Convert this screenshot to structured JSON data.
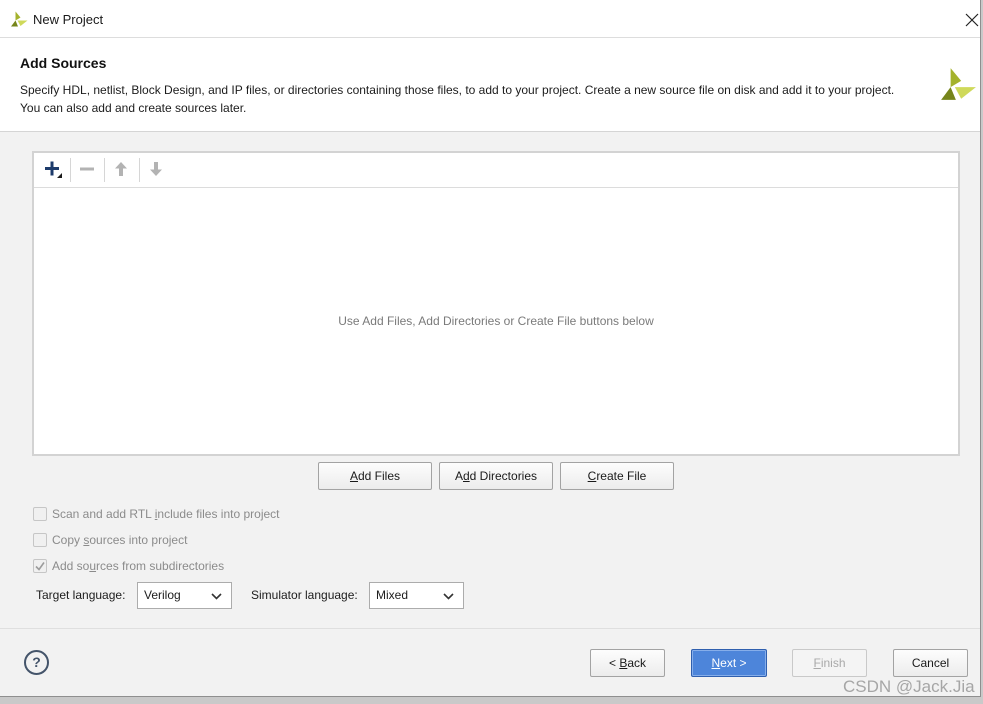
{
  "window": {
    "title": "New Project"
  },
  "header": {
    "title": "Add Sources",
    "description_lines": [
      "Specify HDL, netlist, Block Design, and IP files, or directories containing those files, to add to your project. Create a new source file on disk and add it to your project.",
      "You can also add and create sources later."
    ]
  },
  "sources_panel": {
    "toolbar": [
      {
        "icon": "plus-icon",
        "enabled": true
      },
      {
        "icon": "minus-icon",
        "enabled": false
      },
      {
        "icon": "arrow-up-icon",
        "enabled": false
      },
      {
        "icon": "arrow-down-icon",
        "enabled": false
      }
    ],
    "empty_message": "Use Add Files, Add Directories or Create File buttons below"
  },
  "source_buttons": {
    "add_files": "Add Files",
    "add_directories": "Add Directories",
    "create_file": "Create File"
  },
  "options": [
    {
      "label": "Scan and add RTL include files into project",
      "checked": false,
      "enabled": false
    },
    {
      "label": "Copy sources into project",
      "checked": false,
      "enabled": false
    },
    {
      "label": "Add sources from subdirectories",
      "checked": true,
      "enabled": false
    }
  ],
  "languages": {
    "target_label": "Target language:",
    "target_value": "Verilog",
    "simulator_label": "Simulator language:",
    "simulator_value": "Mixed"
  },
  "footer": {
    "help_label": "?",
    "back_label": "< Back",
    "next_label": "Next >",
    "finish_label": "Finish",
    "cancel_label": "Cancel",
    "back_enabled": true,
    "next_enabled": true,
    "finish_enabled": false,
    "cancel_enabled": true
  },
  "watermark": "CSDN @Jack.Jia",
  "icons": {
    "app": "vivado-app-icon",
    "close": "close-icon",
    "logo": "vivado-logo-icon",
    "help": "help-icon",
    "dropdown": "chevron-down-icon",
    "checkmark": "checkmark-icon"
  },
  "colors": {
    "primary_button": "#4d85da",
    "add_icon": "#1d3b6b",
    "logo_light": "#cfd95a",
    "logo_mid": "#a4b22c",
    "logo_dark": "#76851b"
  }
}
